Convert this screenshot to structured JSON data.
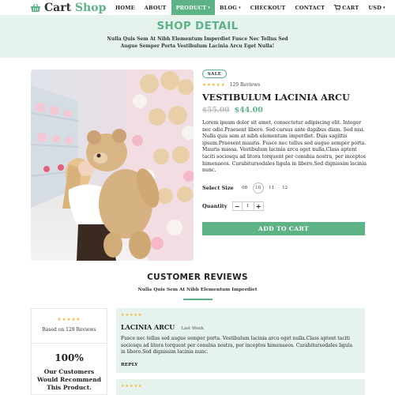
{
  "nav": {
    "logo_primary": "Cart",
    "logo_accent": "Shop",
    "items": [
      {
        "label": "HOME"
      },
      {
        "label": "ABOUT"
      },
      {
        "label": "PRODUCT",
        "caret": "▾",
        "active": true
      },
      {
        "label": "BLOG",
        "caret": "▾"
      },
      {
        "label": "CHECKOUT"
      },
      {
        "label": "CONTACT"
      },
      {
        "label": "CART",
        "icon": "cart-icon"
      },
      {
        "label": "USD",
        "caret": "▾"
      }
    ],
    "search_icon": "search-icon"
  },
  "hero": {
    "title": "SHOP DETAIL",
    "subtitle": "Nulla Quis Sem At Nibh Elementum Imperdiet Fusce Nec Tellus Sed Augue Semper Porta Vestibulum Lacinia Arcu Eget Nulla!"
  },
  "product": {
    "badge": "SALE",
    "stars": "★★★★★",
    "review_count": "129 Reviews",
    "title": "VESTIBULUM LACINIA ARCU",
    "old_price": "$55.00",
    "new_price": "$44.00",
    "description": "Lorem ipsum dolor sit amet, consectetur adipiscing elit. Integer nec odio.Praesent libero. Sed cursus ante dapibus diam. Sed nisi. Nulla quis sem at nibh elementum imperdiet. Duis sagittis ipsum.Praesent mauris. Fusce nec tellus sed augue semper porta. Mauris massa. Vestibulum lacinia arcu eget nulla.Class aptent taciti sociosqu ad litora torquent per conubia nostra, per inceptos himenaeos. Curabitursodales ligula in libero.Sed dignissim lacinia nunc.",
    "size_label": "Select Size",
    "sizes": [
      "08",
      "10",
      "11",
      "12"
    ],
    "selected_size": "10",
    "quantity_label": "Quantity",
    "quantity": "1",
    "minus": "−",
    "plus": "+",
    "add_to_cart": "ADD TO CART"
  },
  "reviews": {
    "title": "CUSTOMER REVIEWS",
    "subtitle": "Nulla Quis Sem At Nibh Elementum Imperdiet",
    "summary": {
      "stars": "★★★★★",
      "based_on": "Based on 129 Reviews",
      "percent": "100%",
      "recommend": "Our Customers Would Recommend This Product."
    },
    "items": [
      {
        "stars": "★★★★★",
        "name": "LACINIA ARCU",
        "date": "Last Week",
        "text": "Fusce nec tellus sed augue semper porta. Vestibulum lacinia arcu eget nulla.Class aptent taciti sociosqu ad litora torquent per conubia nostra, per inceptos himenaeos. Curabitursodales ligula in libero.Sed dignissim lacinia nunc.",
        "reply": "REPLY"
      },
      {
        "stars": "★★★★★"
      }
    ]
  },
  "colors": {
    "accent": "#5db386",
    "hero_bg": "#e6f3ec",
    "star": "#f0b42c"
  }
}
